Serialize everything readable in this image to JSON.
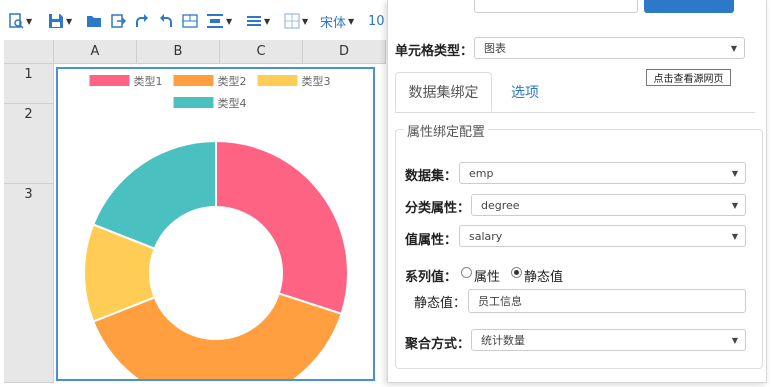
{
  "toolbar": {
    "font_name": "宋体",
    "font_size": "10",
    "icons": [
      "preview-icon",
      "save-icon",
      "open-folder-icon",
      "export-icon",
      "redo-icon",
      "undo-icon",
      "merge-cells-icon",
      "align-center-icon",
      "align-lines-icon",
      "borders-icon"
    ]
  },
  "grid": {
    "columns": [
      "A",
      "B",
      "C",
      "D"
    ],
    "rows": [
      "1",
      "2",
      "3"
    ]
  },
  "chart_data": {
    "type": "pie",
    "donut": true,
    "legend_position": "top",
    "series": [
      {
        "name": "类型1",
        "value": 30,
        "color": "#ff6384"
      },
      {
        "name": "类型2",
        "value": 39,
        "color": "#ff9f40"
      },
      {
        "name": "类型3",
        "value": 12,
        "color": "#ffcd56"
      },
      {
        "name": "类型4",
        "value": 19,
        "color": "#4bc0c0"
      }
    ]
  },
  "panel": {
    "cell_type_label": "单元格类型：",
    "cell_type_value": "图表",
    "tooltip": "点击查看源网页",
    "tabs": [
      "数据集绑定",
      "选项"
    ],
    "section_title": "属性绑定配置",
    "dataset_label": "数据集：",
    "dataset_value": "emp",
    "category_label": "分类属性：",
    "category_value": "degree",
    "value_label": "值属性：",
    "value_value": "salary",
    "series_label": "系列值：",
    "series_options": [
      "属性",
      "静态值"
    ],
    "series_selected": "静态值",
    "static_label": "静态值：",
    "static_value": "员工信息",
    "aggregate_label": "聚合方式：",
    "aggregate_value": "统计数量"
  }
}
